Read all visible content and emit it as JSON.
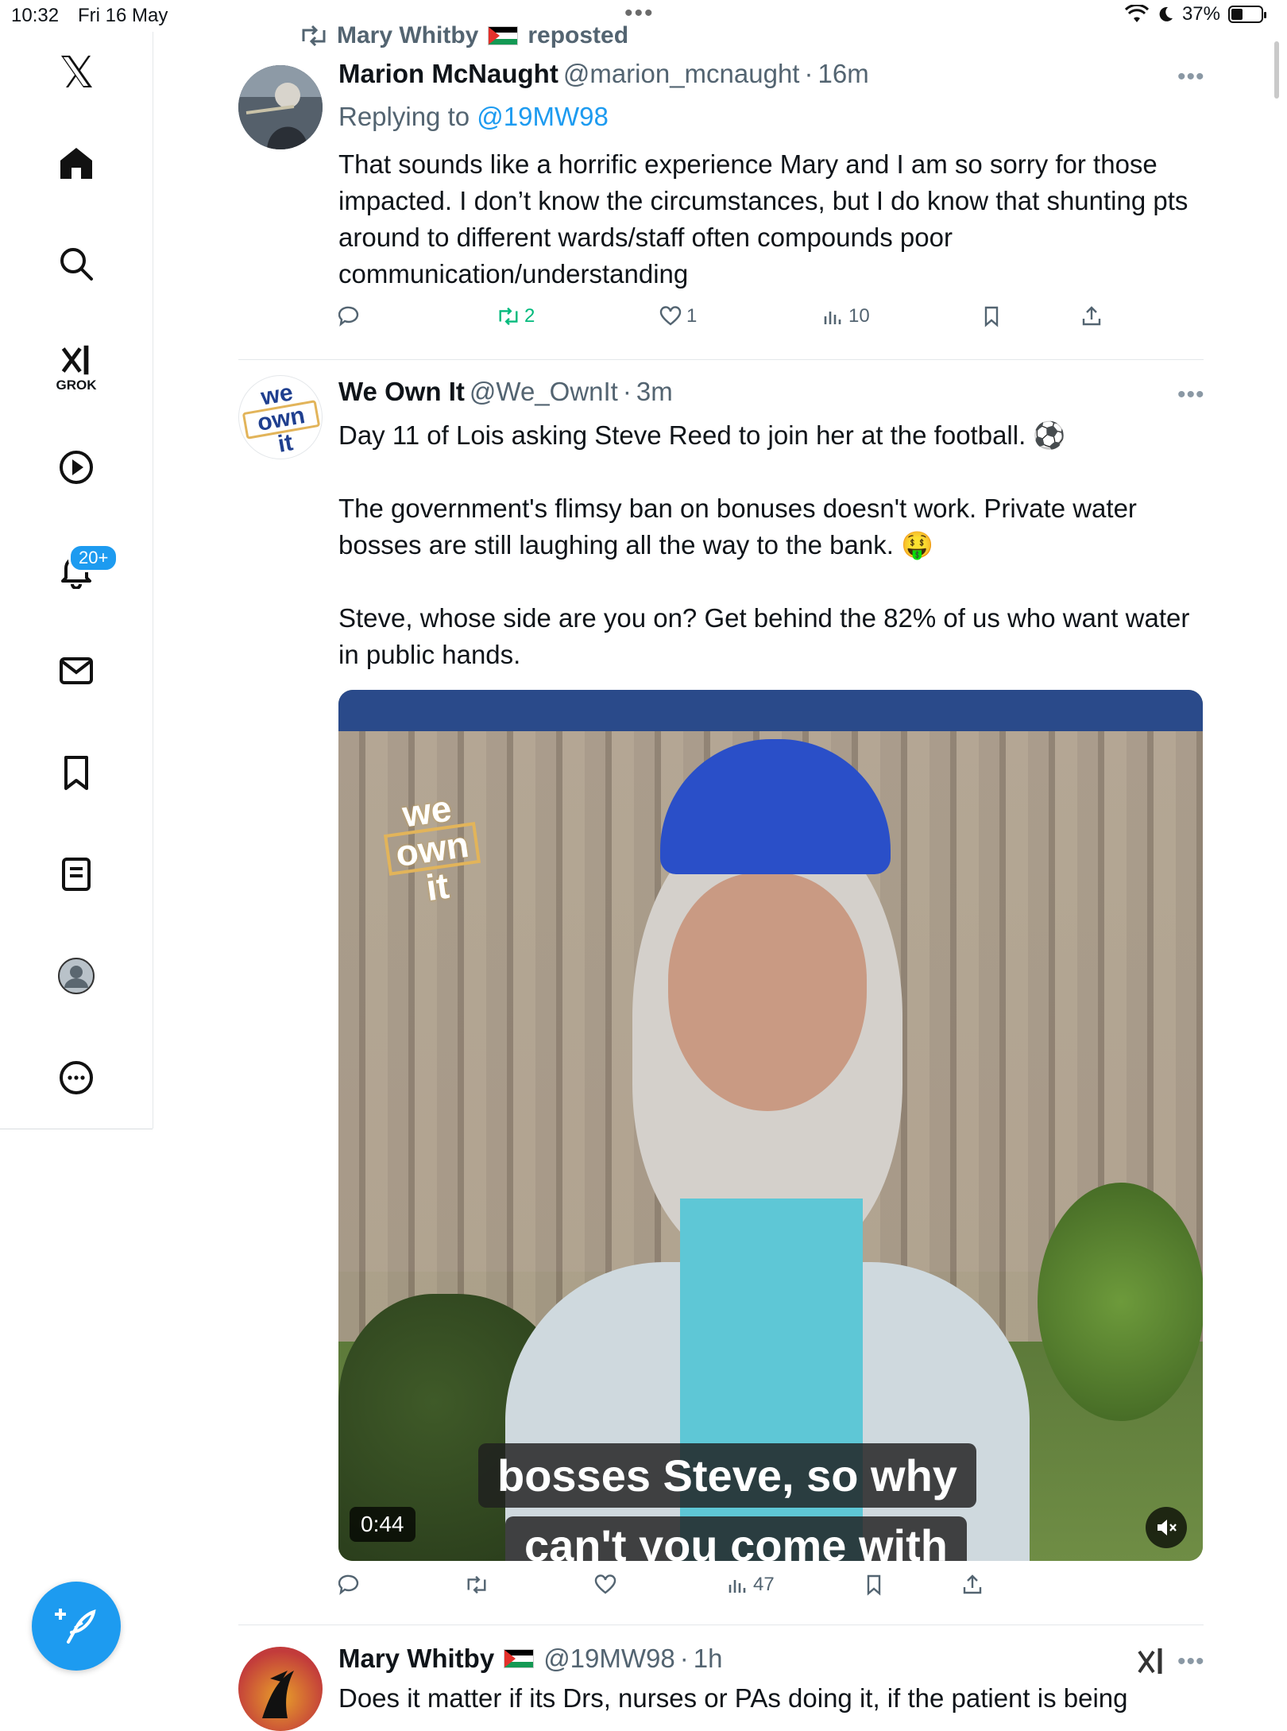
{
  "status_bar": {
    "time": "10:32",
    "date": "Fri 16 May",
    "battery": "37%"
  },
  "sidebar": {
    "grok_label": "GROK",
    "notifications_badge": "20+"
  },
  "tweets": [
    {
      "repost_by": "Mary Whitby",
      "repost_suffix": "reposted",
      "name": "Marion McNaught",
      "handle": "@marion_mcnaught",
      "time": "16m",
      "replying_prefix": "Replying to",
      "replying_to": "@19MW98",
      "text": "That sounds like a horrific experience Mary and I am so sorry for those impacted. I don’t know the circumstances, but I do know that shunting pts around to different wards/staff often compounds poor communication/understanding",
      "reposts": "2",
      "likes": "1",
      "views": "10"
    },
    {
      "name": "We Own It",
      "handle": "@We_OwnIt",
      "time": "3m",
      "avatar_text": [
        "we",
        "own",
        "it"
      ],
      "paragraphs": [
        "Day 11 of Lois asking Steve Reed to join her at the football. ⚽",
        "The government's flimsy ban on bonuses doesn't work. Private water bosses are still laughing all the way to the bank. 🤑",
        "Steve, whose side are you on? Get behind the 82% of us who want water in public hands."
      ],
      "video": {
        "duration": "0:44",
        "caption_line1": "bosses Steve, so why",
        "caption_line2": "can't you come with",
        "watermark": [
          "we",
          "own",
          "it"
        ]
      },
      "views": "47"
    },
    {
      "name": "Mary Whitby",
      "handle": "@19MW98",
      "time": "1h",
      "text": "Does it matter if its Drs, nurses or PAs doing it, if the patient is being"
    }
  ],
  "colors": {
    "accent": "#1d9bf0",
    "repost_green": "#00ba7c",
    "secondary_text": "#536471"
  }
}
